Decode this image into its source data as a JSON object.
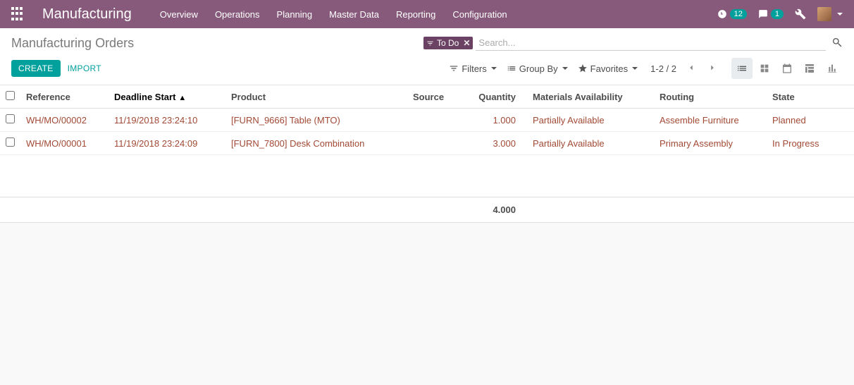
{
  "navbar": {
    "brand": "Manufacturing",
    "menu": [
      "Overview",
      "Operations",
      "Planning",
      "Master Data",
      "Reporting",
      "Configuration"
    ],
    "activity_count": "12",
    "message_count": "1"
  },
  "breadcrumb": "Manufacturing Orders",
  "buttons": {
    "create": "CREATE",
    "import": "IMPORT"
  },
  "search": {
    "active_filter": "To Do",
    "placeholder": "Search..."
  },
  "toolbar": {
    "filters": "Filters",
    "groupby": "Group By",
    "favorites": "Favorites"
  },
  "pager": {
    "range": "1-2 / 2"
  },
  "columns": {
    "reference": "Reference",
    "deadline": "Deadline Start",
    "product": "Product",
    "source": "Source",
    "quantity": "Quantity",
    "availability": "Materials Availability",
    "routing": "Routing",
    "state": "State"
  },
  "rows": [
    {
      "reference": "WH/MO/00002",
      "deadline": "11/19/2018 23:24:10",
      "product": "[FURN_9666] Table (MTO)",
      "source": "",
      "quantity": "1.000",
      "availability": "Partially Available",
      "routing": "Assemble Furniture",
      "state": "Planned"
    },
    {
      "reference": "WH/MO/00001",
      "deadline": "11/19/2018 23:24:09",
      "product": "[FURN_7800] Desk Combination",
      "source": "",
      "quantity": "3.000",
      "availability": "Partially Available",
      "routing": "Primary Assembly",
      "state": "In Progress"
    }
  ],
  "totals": {
    "quantity": "4.000"
  }
}
